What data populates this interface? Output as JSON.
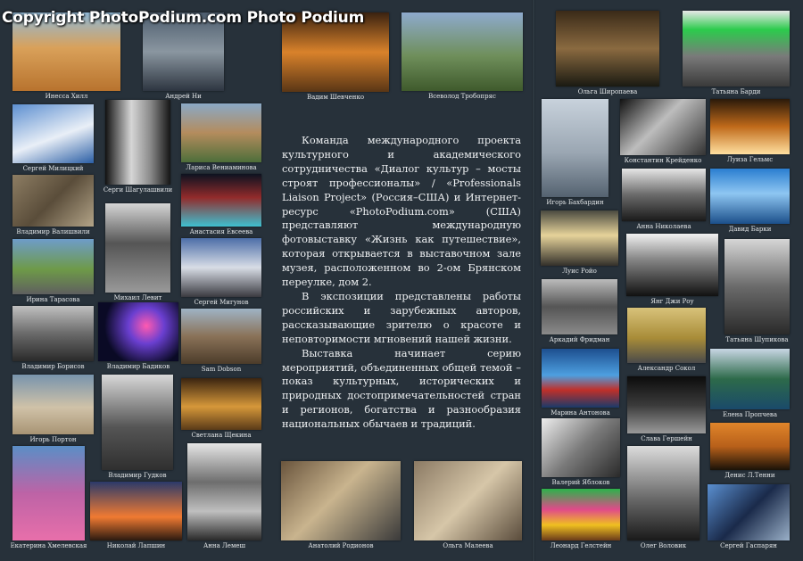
{
  "watermark": "Copyright PhotoPodium.com Photo Podium",
  "body_text": {
    "p1": "Команда международного проекта культурного и академического сотрудничества «Диалог культур – мосты строят профессионалы» / «Professionals Liaison Project» (Россия–США) и Интернет-ресурс «PhotoPodium.com» (США) представляют международную фотовыставку «Жизнь как путешествие», которая открывается в выставочном зале музея, расположенном во 2-ом  Брянском переулке,  дом 2.",
    "p2": "В экспозиции представлены работы российских и зарубежных авторов, рассказывающие зрителю о красоте и неповторимости мгновений нашей жизни.",
    "p3": "Выставка  начинает серию мероприятий, объединенных общей темой – показ культурных, исторических и природных достопримечательностей стран и регионов, богатства и разнообразия национальных обычаев и традиций."
  },
  "photo_captions": [
    "Инесса Хилл",
    "Андрей Ни",
    "Вадим Шевченко",
    "Всеволод Тробопряс",
    "Сергей Милицкий",
    "Серги Шагулашвили",
    "Лариса Вениаминова",
    "Владимир Валишвили",
    "Анастасия Евсеева",
    "Ирина Тарасова",
    "Михаил Левит",
    "Сергей Мигунов",
    "Владимир Борисов",
    "Владимир Бадиков",
    "Sam Dobson",
    "Игорь Портон",
    "Владимир Гудков",
    "Светлана Щекина",
    "Екатерина Хмелевская",
    "Николай Лапшин",
    "Анна Лемеш",
    "Анатолий Родионов",
    "Ольга Малеева",
    "Ольга Широпаева",
    "Татьяна Барди",
    "Игорь Бахбардин",
    "Константин Крейденко",
    "Луиза Гельмс",
    "Анна Николаева",
    "Давид Барки",
    "Луис Ройо",
    "Янг Джи Роу",
    "Татьяна Шупикова",
    "Аркадий Фридман",
    "Александр Сокол",
    "Марина Антонова",
    "Елена Пропчева",
    "Слава Гершейн",
    "Валерий Яблоков",
    "Денис Л.Тенни",
    "Леонард Гелстейн",
    "Олег Воловик",
    "Сергей Гаспарян"
  ]
}
